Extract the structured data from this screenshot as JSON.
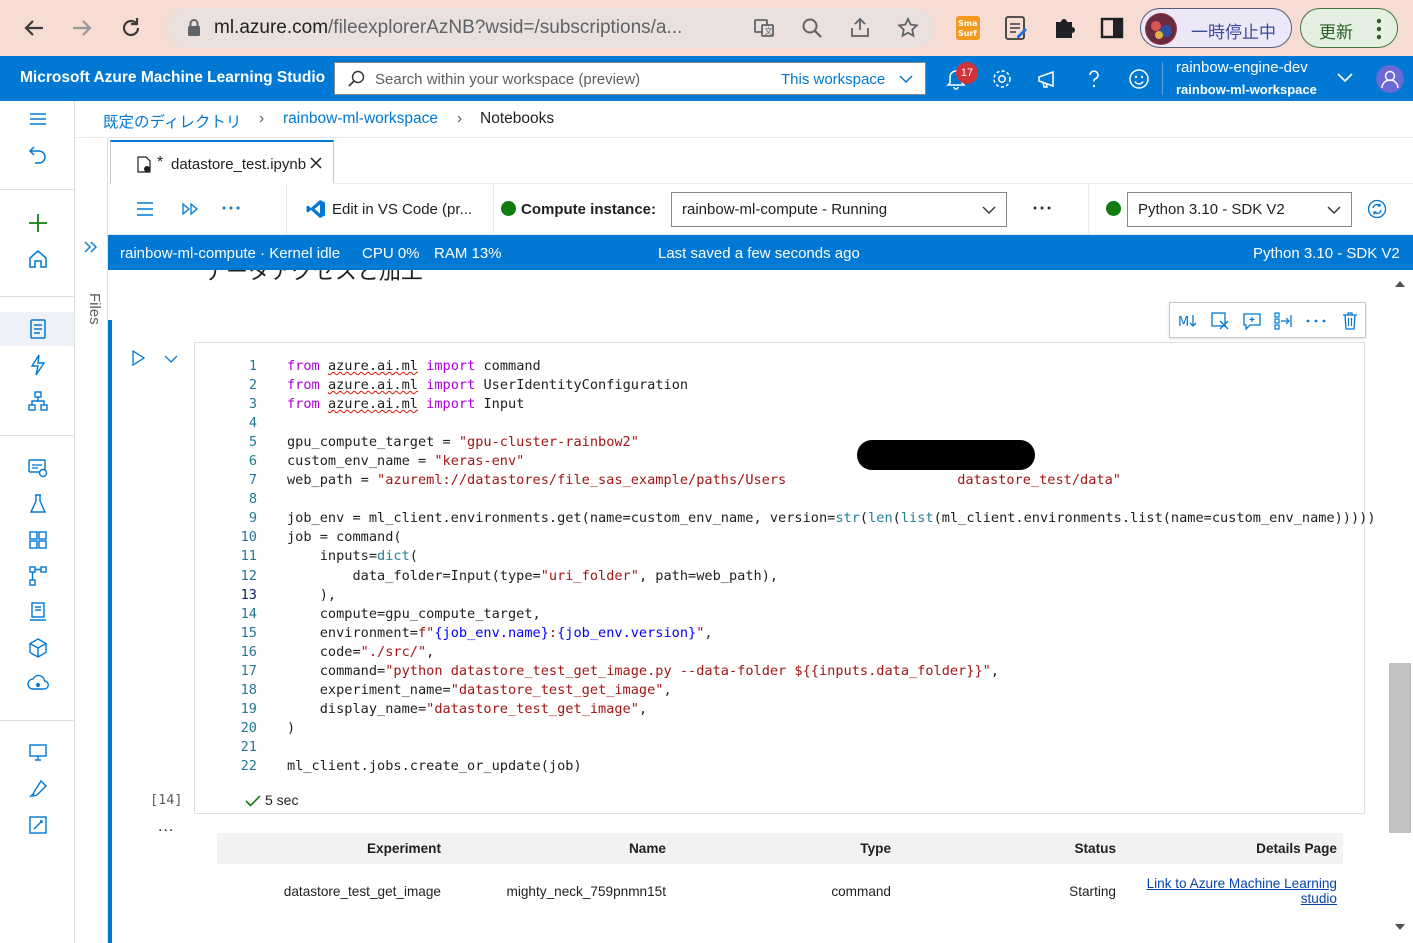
{
  "browser": {
    "url_host": "ml.azure.com",
    "url_rest": "/fileexplorerAzNB?wsid=/subscriptions/a...",
    "profile_label": "一時停止中",
    "update_label": "更新"
  },
  "topbar": {
    "brand": "Microsoft Azure Machine Learning Studio",
    "search_placeholder": "Search within your workspace (preview)",
    "search_scope": "This workspace",
    "notification_count": "17",
    "account_name": "rainbow-engine-dev",
    "workspace_name": "rainbow-ml-workspace"
  },
  "breadcrumb": {
    "items": [
      "既定のディレクトリ",
      "rainbow-ml-workspace",
      "Notebooks"
    ]
  },
  "files_rail": {
    "label": "Files"
  },
  "tab": {
    "modified_mark": "*",
    "filename": "datastore_test.ipynb"
  },
  "toolbar": {
    "edit_vscode": "Edit in VS Code (pr...",
    "compute_label": "Compute instance:",
    "compute_value": "rainbow-ml-compute    -    Running",
    "kernel_value": "Python 3.10 - SDK V2"
  },
  "statusbar": {
    "kernel_status": "rainbow-ml-compute · Kernel idle",
    "cpu": "CPU  0%",
    "ram": "RAM 13%",
    "saved": "Last saved a few seconds ago",
    "kernel_name": "Python 3.10 - SDK V2"
  },
  "notebook": {
    "heading_fragment": "データアクセスと加工",
    "exec_count": "[14]",
    "exec_time": "5 sec",
    "output_more": "...",
    "code": {
      "l1a": "azure.ai.ml",
      "l1b": "command",
      "l2a": "azure.ai.ml",
      "l2b": "UserIdentityConfiguration",
      "l3a": "azure.ai.ml",
      "l3b": "Input",
      "l5a": "gpu_compute_target = ",
      "l5b": "\"gpu-cluster-rainbow2\"",
      "l6a": "custom_env_name = ",
      "l6b": "\"keras-env\"",
      "l7a": "web_path = ",
      "l7b": "\"azureml://datastores/file_sas_example/paths/Users",
      "l7c": "datastore_test/data\"",
      "l9a": "job_env = ml_client.environments.get(name=custom_env_name, version=",
      "l9b": "str",
      "l9c": "(",
      "l9d": "len",
      "l9e": "(",
      "l9f": "list",
      "l9g": "(ml_client.environments.list(name=custom_env_name)))))",
      "l10": "job = command(",
      "l11a": "    inputs=",
      "l11b": "dict",
      "l11c": "(",
      "l12a": "        data_folder=Input(type=",
      "l12b": "\"uri_folder\"",
      "l12c": ", path=web_path),",
      "l13": "    ),",
      "l14": "    compute=gpu_compute_target,",
      "l15a": "    environment=",
      "l15b": "f\"",
      "l15c": "{job_env.name}",
      "l15d": ":",
      "l15e": "{job_env.version}",
      "l15f": "\"",
      "l15g": ",",
      "l16a": "    code=",
      "l16b": "\"./src/\"",
      "l16c": ",",
      "l17a": "    command=",
      "l17b": "\"python datastore_test_get_image.py --data-folder ${{inputs.data_folder}}\"",
      "l17c": ",",
      "l18a": "    experiment_name=",
      "l18b": "\"datastore_test_get_image\"",
      "l18c": ",",
      "l19a": "    display_name=",
      "l19b": "\"datastore_test_get_image\"",
      "l19c": ",",
      "l20": ")",
      "l22": "ml_client.jobs.create_or_update(job)"
    },
    "output_table": {
      "headers": [
        "Experiment",
        "Name",
        "Type",
        "Status",
        "Details Page"
      ],
      "row": [
        "datastore_test_get_image",
        "mighty_neck_759pnmn15t",
        "command",
        "Starting"
      ],
      "link_line1": "Link to Azure Machine Learning",
      "link_line2": "studio"
    }
  },
  "colors": {
    "azure_blue": "#0078d4",
    "chrome_bg": "#f6dcd2",
    "running_green": "#107c10"
  }
}
